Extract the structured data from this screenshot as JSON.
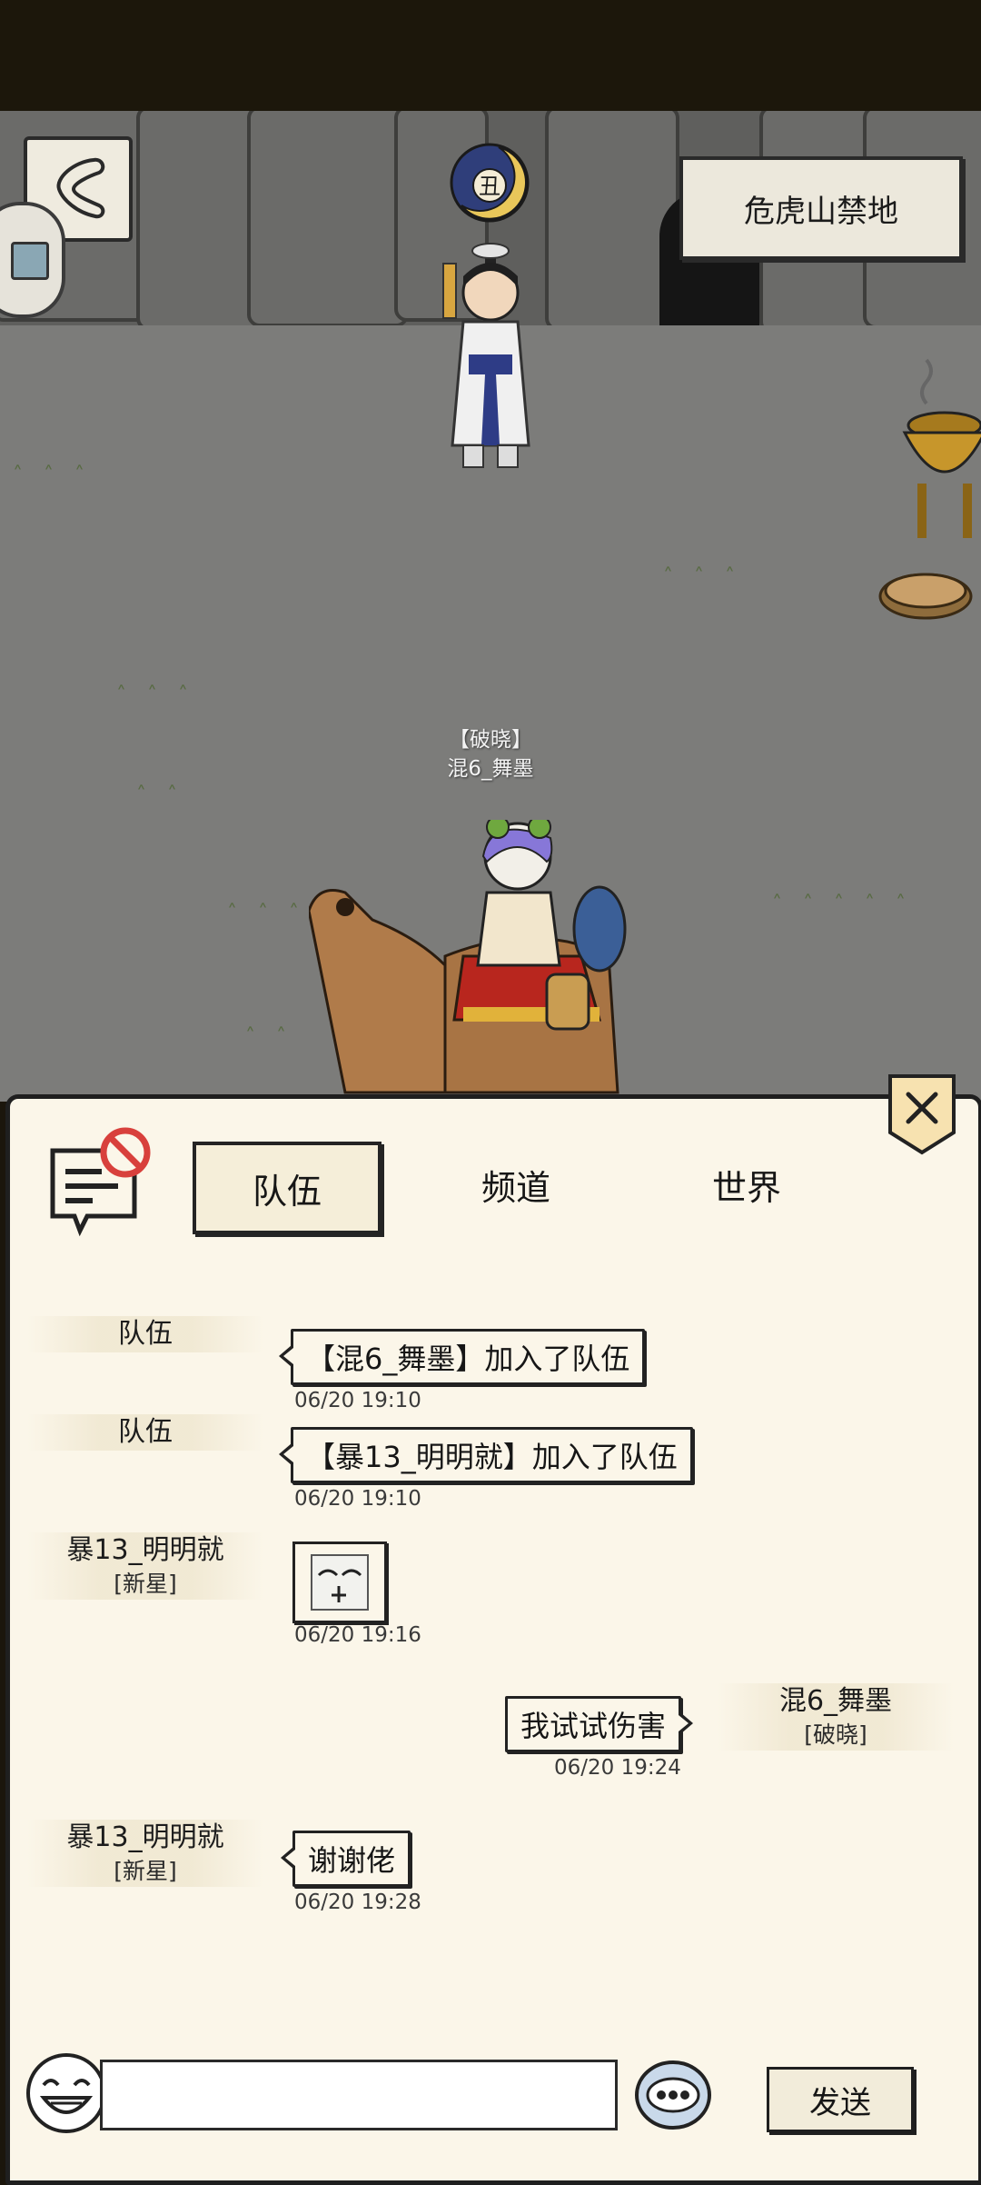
{
  "header": {
    "location_name": "危虎山禁地"
  },
  "npc_badge": {
    "glyph": "丑"
  },
  "player": {
    "guild_tag": "【破晓】",
    "name": "混6_舞墨"
  },
  "chat": {
    "tabs": [
      {
        "label": "队伍",
        "active": true
      },
      {
        "label": "频道",
        "active": false
      },
      {
        "label": "世界",
        "active": false
      }
    ],
    "messages": [
      {
        "sender": "队伍",
        "rank": "",
        "text": "【混6_舞墨】加入了队伍",
        "time": "06/20 19:10",
        "side": "left"
      },
      {
        "sender": "队伍",
        "rank": "",
        "text": "【暴13_明明就】加入了队伍",
        "time": "06/20 19:10",
        "side": "left"
      },
      {
        "sender": "暴13_明明就",
        "rank": "[新星]",
        "text": "",
        "sticker": "sticker-face-icon",
        "time": "06/20 19:16",
        "side": "left"
      },
      {
        "sender": "混6_舞墨",
        "rank": "[破晓]",
        "text": "我试试伤害",
        "time": "06/20 19:24",
        "side": "right"
      },
      {
        "sender": "暴13_明明就",
        "rank": "[新星]",
        "text": "谢谢佬",
        "time": "06/20 19:28",
        "side": "left"
      }
    ],
    "input_placeholder": "",
    "send_label": "发送"
  },
  "icons": {
    "back": "back-arrow-icon",
    "close": "close-icon",
    "mute": "mute-chat-icon",
    "emoji": "emoji-icon",
    "more": "more-icon"
  },
  "colors": {
    "panel_bg": "#fbf6e9",
    "ink": "#1f1f1f",
    "scene_ground": "#7c7c7a",
    "top_bar": "#1c170b"
  }
}
